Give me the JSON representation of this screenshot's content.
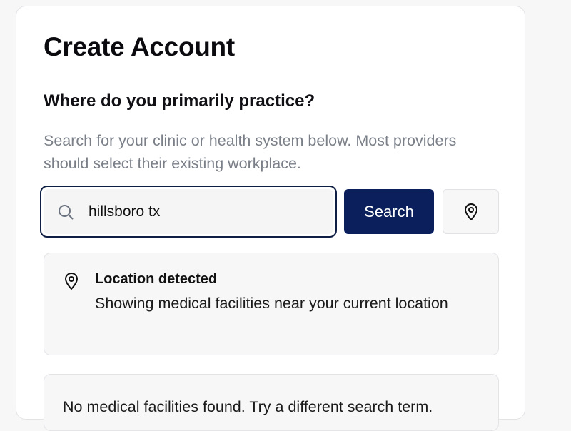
{
  "page": {
    "title": "Create Account",
    "question": "Where do you primarily practice?",
    "description": "Search for your clinic or health system below. Most providers should select their existing workplace."
  },
  "search": {
    "value": "hillsboro tx",
    "button_label": "Search",
    "icon": "search-icon",
    "location_icon": "map-pin-icon"
  },
  "notice": {
    "icon": "map-pin-icon",
    "title": "Location detected",
    "message": "Showing medical facilities near your current location"
  },
  "results": {
    "empty_message": "No medical facilities found. Try a different search term."
  },
  "colors": {
    "primary_button": "#0a1f5c",
    "focus_border": "#0f1e45",
    "muted_text": "#7a7f88"
  }
}
